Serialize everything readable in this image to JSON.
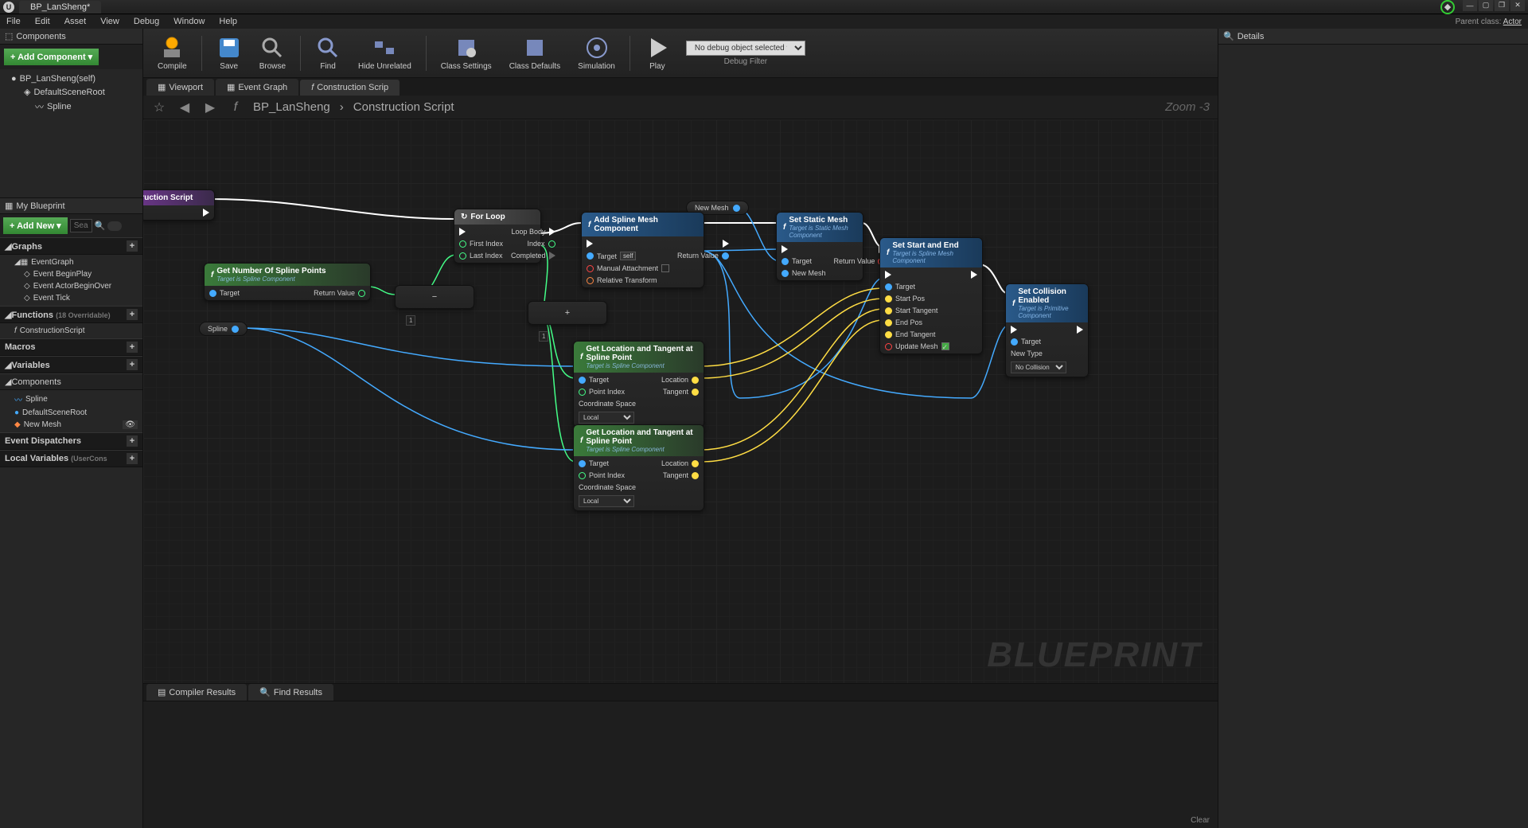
{
  "titlebar": {
    "tab": "BP_LanSheng*"
  },
  "menu": [
    "File",
    "Edit",
    "Asset",
    "View",
    "Debug",
    "Window",
    "Help"
  ],
  "parent_class": {
    "label": "Parent class:",
    "value": "Actor"
  },
  "components": {
    "header": "Components",
    "add_btn": "+ Add Component ▾",
    "root": "BP_LanSheng(self)",
    "scene_root": "DefaultSceneRoot",
    "spline": "Spline"
  },
  "myblueprint": {
    "header": "My Blueprint",
    "add_btn": "+ Add New ▾",
    "search_ph": "Sea",
    "graphs": {
      "hdr": "Graphs",
      "items": [
        "EventGraph",
        "Event BeginPlay",
        "Event ActorBeginOver",
        "Event Tick"
      ]
    },
    "functions": {
      "hdr": "Functions",
      "note": "(18 Overridable)",
      "items": [
        "ConstructionScript"
      ]
    },
    "macros": {
      "hdr": "Macros"
    },
    "variables": {
      "hdr": "Variables"
    },
    "comp_section": {
      "hdr": "Components",
      "items": [
        "Spline",
        "DefaultSceneRoot",
        "New Mesh"
      ]
    },
    "dispatchers": {
      "hdr": "Event Dispatchers"
    },
    "locals": {
      "hdr": "Local Variables",
      "note": "(UserCons"
    }
  },
  "toolbar": {
    "buttons": [
      "Compile",
      "Save",
      "Browse",
      "Find",
      "Hide Unrelated",
      "Class Settings",
      "Class Defaults",
      "Simulation",
      "Play"
    ],
    "debug_select": "No debug object selected ▾",
    "debug_filter": "Debug Filter"
  },
  "graph_tabs": [
    "Viewport",
    "Event Graph",
    "Construction Scrip"
  ],
  "breadcrumb": {
    "bp": "BP_LanSheng",
    "graph": "Construction Script",
    "zoom": "Zoom -3"
  },
  "nodes": {
    "cs": {
      "title": "Construction Script"
    },
    "getnum": {
      "title": "Get Number Of Spline Points",
      "sub": "Target is Spline Component",
      "target": "Target",
      "rv": "Return Value"
    },
    "forloop": {
      "title": "For Loop",
      "first": "First Index",
      "last": "Last Index",
      "body": "Loop Body",
      "index": "Index",
      "completed": "Completed"
    },
    "spline_var": "Spline",
    "newmesh_var": "New Mesh",
    "addspline": {
      "title": "Add Spline Mesh Component",
      "target": "Target",
      "self": "self",
      "manual": "Manual Attachment",
      "rel": "Relative Transform",
      "rv": "Return Value"
    },
    "getloc": {
      "title": "Get Location and Tangent at Spline Point",
      "sub": "Target is Spline Component",
      "target": "Target",
      "pidx": "Point Index",
      "cspace": "Coordinate Space",
      "local": "Local",
      "loc": "Location",
      "tan": "Tangent"
    },
    "setsm": {
      "title": "Set Static Mesh",
      "sub": "Target is Static Mesh Component",
      "target": "Target",
      "newmesh": "New Mesh",
      "rv": "Return Value"
    },
    "setse": {
      "title": "Set Start and End",
      "sub": "Target is Spline Mesh Component",
      "target": "Target",
      "sp": "Start Pos",
      "st": "Start Tangent",
      "ep": "End Pos",
      "et": "End Tangent",
      "um": "Update Mesh"
    },
    "setcol": {
      "title": "Set Collision Enabled",
      "sub": "Target is Primitive Component",
      "target": "Target",
      "newtype": "New Type",
      "nocol": "No Collision"
    },
    "idx": "1"
  },
  "bottom_tabs": [
    "Compiler Results",
    "Find Results"
  ],
  "clear": "Clear",
  "details": {
    "header": "Details"
  },
  "watermark": "BLUEPRINT"
}
